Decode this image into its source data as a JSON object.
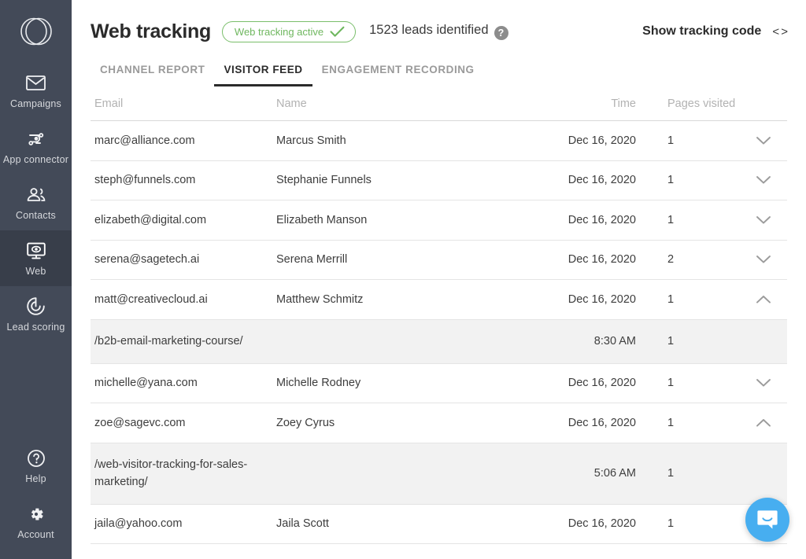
{
  "sidebar": {
    "logo": "overlapping-circles-logo",
    "items": [
      {
        "id": "campaigns",
        "label": "Campaigns",
        "icon": "envelope-icon",
        "active": false
      },
      {
        "id": "app-connector",
        "label": "App connector",
        "icon": "connector-icon",
        "active": false
      },
      {
        "id": "contacts",
        "label": "Contacts",
        "icon": "people-icon",
        "active": false
      },
      {
        "id": "web",
        "label": "Web",
        "icon": "monitor-eye-icon",
        "active": true
      },
      {
        "id": "lead-scoring",
        "label": "Lead scoring",
        "icon": "target-icon",
        "active": false
      }
    ],
    "bottom_items": [
      {
        "id": "help",
        "label": "Help",
        "icon": "question-circle-icon"
      },
      {
        "id": "account",
        "label": "Account",
        "icon": "gear-icon"
      }
    ],
    "bg_color": "#434A58",
    "active_bg_color": "#383E4A"
  },
  "header": {
    "title": "Web tracking",
    "status_badge": {
      "label": "Web tracking active",
      "icon": "check-icon",
      "color": "#6FB75F"
    },
    "leads_text": "1523 leads identified",
    "help_icon": "question-mark-badge",
    "show_tracking_code": "Show tracking code",
    "code_icon": "< >"
  },
  "tabs": [
    {
      "label": "CHANNEL REPORT",
      "active": false
    },
    {
      "label": "VISITOR FEED",
      "active": true
    },
    {
      "label": "ENGAGEMENT RECORDING",
      "active": false
    }
  ],
  "table": {
    "columns": [
      "Email",
      "Name",
      "Time",
      "Pages visited"
    ],
    "rows": [
      {
        "type": "visitor",
        "email": "marc@alliance.com",
        "name": "Marcus Smith",
        "time": "Dec 16, 2020",
        "pages": "1",
        "expanded": false,
        "chevron": "chevron-down-icon"
      },
      {
        "type": "visitor",
        "email": "steph@funnels.com",
        "name": "Stephanie Funnels",
        "time": "Dec 16, 2020",
        "pages": "1",
        "expanded": false,
        "chevron": "chevron-down-icon"
      },
      {
        "type": "visitor",
        "email": "elizabeth@digital.com",
        "name": "Elizabeth Manson",
        "time": "Dec 16, 2020",
        "pages": "1",
        "expanded": false,
        "chevron": "chevron-down-icon"
      },
      {
        "type": "visitor",
        "email": "serena@sagetech.ai",
        "name": "Serena Merrill",
        "time": "Dec 16, 2020",
        "pages": "2",
        "expanded": false,
        "chevron": "chevron-down-icon"
      },
      {
        "type": "visitor",
        "email": "matt@creativecloud.ai",
        "name": "Matthew Schmitz",
        "time": "Dec 16, 2020",
        "pages": "1",
        "expanded": true,
        "chevron": "chevron-up-icon"
      },
      {
        "type": "detail",
        "page": "/b2b-email-marketing-course/",
        "name": "",
        "time": "8:30 AM",
        "pages": "1"
      },
      {
        "type": "visitor",
        "email": "michelle@yana.com",
        "name": "Michelle Rodney",
        "time": "Dec 16, 2020",
        "pages": "1",
        "expanded": false,
        "chevron": "chevron-down-icon"
      },
      {
        "type": "visitor",
        "email": "zoe@sagevc.com",
        "name": "Zoey Cyrus",
        "time": "Dec 16, 2020",
        "pages": "1",
        "expanded": true,
        "chevron": "chevron-up-icon"
      },
      {
        "type": "detail",
        "page": "/web-visitor-tracking-for-sales-marketing/",
        "name": "",
        "time": "5:06 AM",
        "pages": "1",
        "tall": true
      },
      {
        "type": "visitor",
        "email": "jaila@yahoo.com",
        "name": "Jaila Scott",
        "time": "Dec 16, 2020",
        "pages": "1",
        "expanded": false,
        "chevron": "chevron-down-icon"
      }
    ]
  },
  "chat_widget": {
    "icon": "chat-bubble-icon",
    "color": "#47AEF0"
  }
}
